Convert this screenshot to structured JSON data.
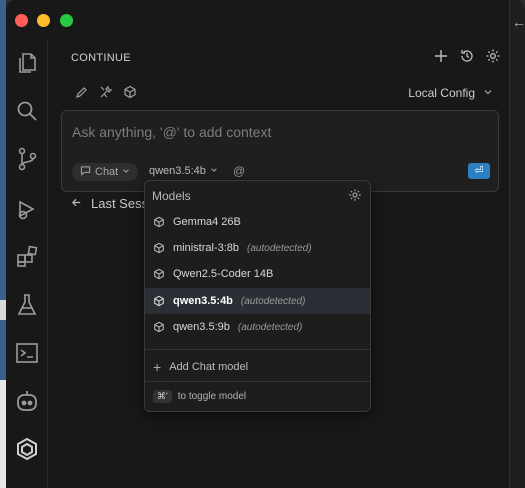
{
  "panel": {
    "title": "CONTINUE",
    "local_config": "Local Config"
  },
  "input": {
    "placeholder": "Ask anything, '@' to add context",
    "mode": "Chat",
    "model": "qwen3.5:4b",
    "at": "@",
    "submit_icon": "enter-icon"
  },
  "sessions": {
    "label": "Last Sessions"
  },
  "models_dropdown": {
    "title": "Models",
    "items": [
      {
        "name": "Gemma4 26B",
        "tag": ""
      },
      {
        "name": "ministral-3:8b",
        "tag": "(autodetected)"
      },
      {
        "name": "Qwen2.5-Coder 14B",
        "tag": ""
      },
      {
        "name": "qwen3.5:4b",
        "tag": "(autodetected)",
        "selected": true
      },
      {
        "name": "qwen3.5:9b",
        "tag": "(autodetected)"
      }
    ],
    "add_label": "Add Chat model",
    "hint_key": "⌘'",
    "hint_text": "to toggle model"
  },
  "colors": {
    "accent": "#2c7fc1",
    "bg": "#181818"
  },
  "activity_icons": [
    "files-icon",
    "search-icon",
    "source-control-icon",
    "debug-icon",
    "extensions-icon",
    "testing-icon",
    "terminal-icon",
    "copilot-icon",
    "continue-icon"
  ]
}
